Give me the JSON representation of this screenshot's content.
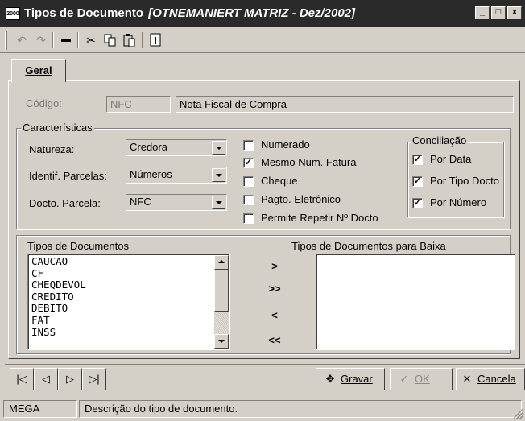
{
  "window": {
    "app_icon": "2000",
    "title": "Tipos de Documento",
    "subtitle": "[OTNEMANIERT MATRIZ - Dez/2002]",
    "controls": [
      "_",
      "□",
      "x"
    ]
  },
  "toolbar": {
    "icons": [
      "undo-icon",
      "redo-icon",
      "delete-icon",
      "cut-icon",
      "copy-icon",
      "paste-icon",
      "info-icon"
    ]
  },
  "tabs": [
    {
      "label": "Geral",
      "active": true
    }
  ],
  "form": {
    "codigo_label": "Código:",
    "codigo_value": "NFC",
    "descricao_value": "Nota Fiscal de Compra"
  },
  "caracteristicas": {
    "title": "Características",
    "natureza_label": "Natureza:",
    "natureza_value": "Credora",
    "parcelas_label": "Identif. Parcelas:",
    "parcelas_value": "Números",
    "docto_label": "Docto. Parcela:",
    "docto_value": "NFC",
    "checkboxes": [
      {
        "label": "Numerado",
        "checked": false
      },
      {
        "label": "Mesmo Num. Fatura",
        "checked": true
      },
      {
        "label": "Cheque",
        "checked": false
      },
      {
        "label": "Pagto. Eletrônico",
        "checked": false
      },
      {
        "label": "Permite Repetir Nº Docto",
        "checked": false
      }
    ]
  },
  "conciliacao": {
    "title": "Conciliação",
    "checkboxes": [
      {
        "label": "Por Data",
        "checked": true
      },
      {
        "label": "Por Tipo Docto",
        "checked": true
      },
      {
        "label": "Por Número",
        "checked": true
      }
    ]
  },
  "lists": {
    "left_title": "Tipos de Documentos",
    "right_title": "Tipos de Documentos para Baixa",
    "left_items": [
      "CAUCAO",
      "CF",
      "CHEQDEVOL",
      "CREDITO",
      "DEBITO",
      "FAT",
      "INSS"
    ],
    "right_items": [],
    "move_buttons": [
      ">",
      ">>",
      "<",
      "<<"
    ]
  },
  "navigation": {
    "first": "|◁",
    "prev": "◁",
    "next": "▷",
    "last": "▷|"
  },
  "actions": {
    "save_label": "Gravar",
    "ok_label": "OK",
    "cancel_label": "Cancela"
  },
  "status": {
    "user": "MEGA",
    "message": "Descrição do tipo de documento."
  }
}
